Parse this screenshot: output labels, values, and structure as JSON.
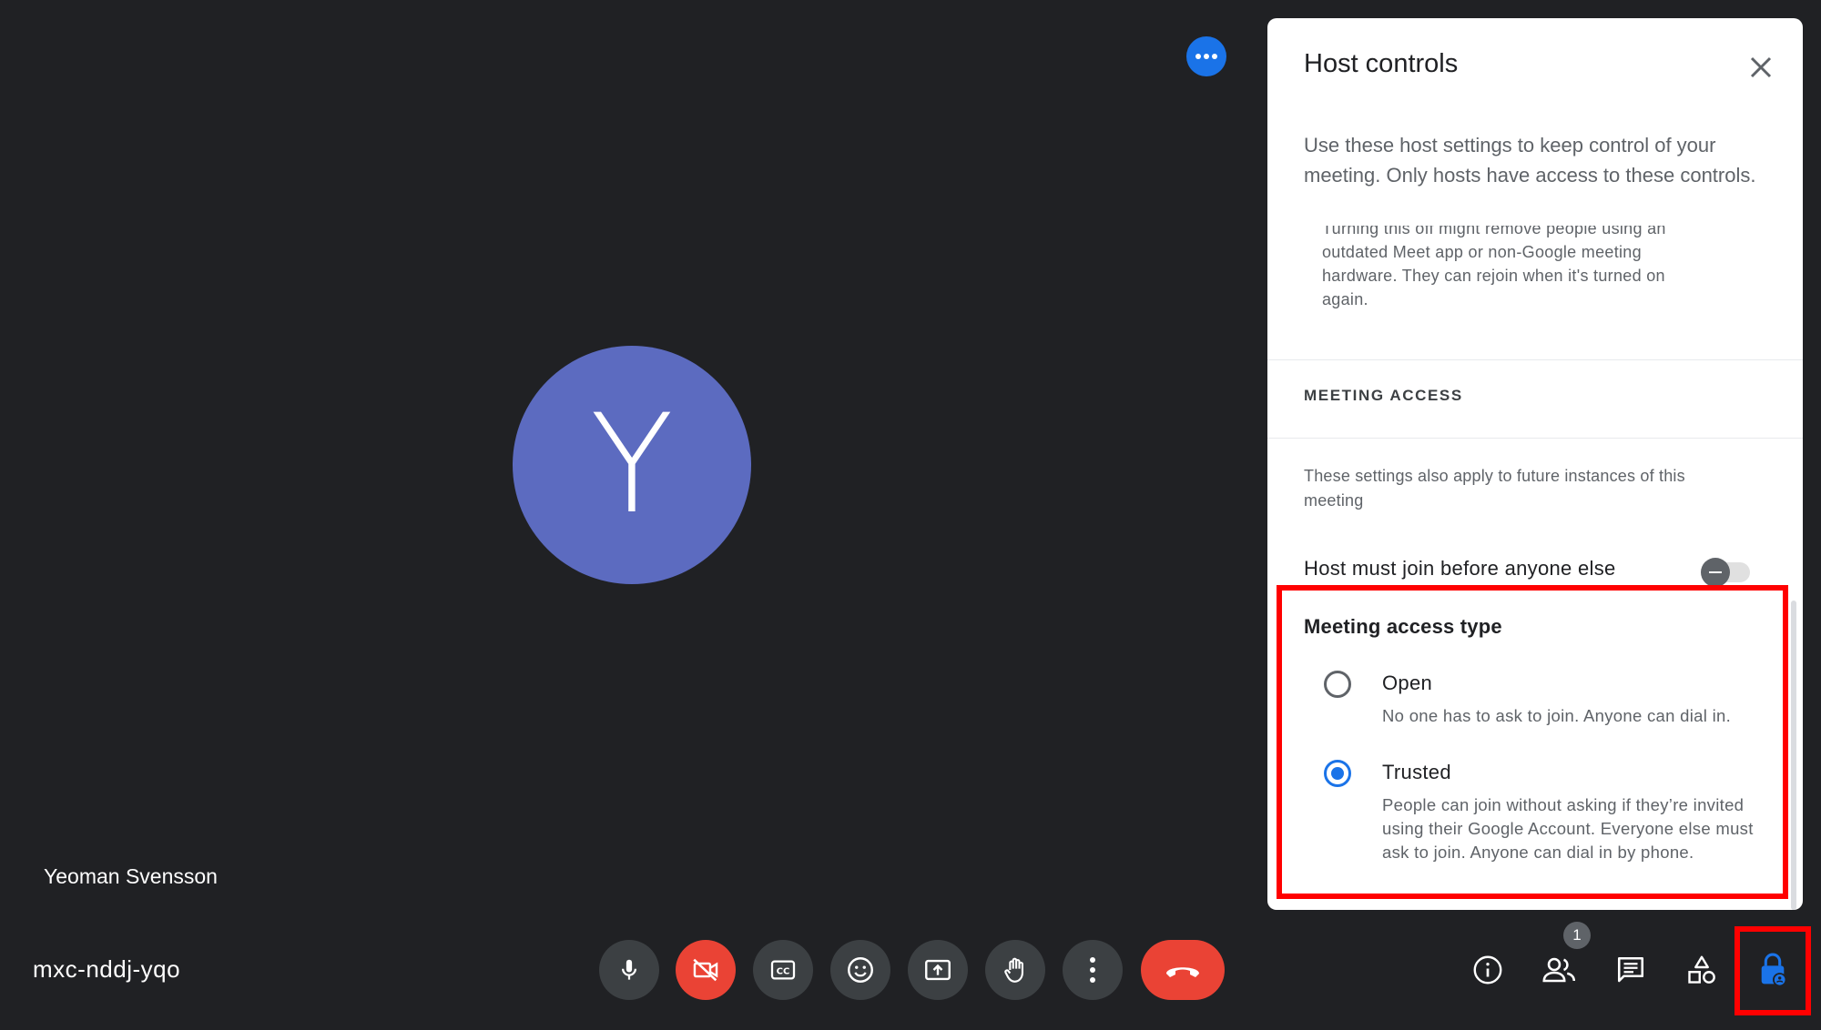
{
  "stage": {
    "avatar_letter": "Y",
    "participant_name": "Yeoman Svensson",
    "more_options_icon": "more-horiz-icon"
  },
  "bottom_bar": {
    "meeting_code": "mxc-nddj-yqo",
    "controls": [
      {
        "icon": "mic-icon"
      },
      {
        "icon": "camera-off-icon",
        "color": "#ea4335"
      },
      {
        "icon": "captions-icon"
      },
      {
        "icon": "emoji-icon"
      },
      {
        "icon": "present-icon"
      },
      {
        "icon": "raise-hand-icon"
      },
      {
        "icon": "more-vert-icon"
      },
      {
        "icon": "hang-up-icon",
        "color": "#ea4335"
      }
    ],
    "right_controls": [
      {
        "icon": "info-icon"
      },
      {
        "icon": "people-icon",
        "badge": "1"
      },
      {
        "icon": "chat-icon"
      },
      {
        "icon": "activities-icon"
      },
      {
        "icon": "host-controls-lock-icon",
        "color": "#1a73e8"
      }
    ]
  },
  "panel": {
    "title": "Host controls",
    "intro": "Use these host settings to keep control of your meeting. Only hosts have access to these controls.",
    "clipped_note": "Turning this off might remove people using an outdated Meet app or non-Google meeting hardware. They can rejoin when it's turned on again.",
    "section_heading": "MEETING ACCESS",
    "section_note": "These settings also apply to future instances of this meeting",
    "host_must_join": {
      "label": "Host must join before anyone else",
      "enabled": false
    },
    "access_type": {
      "title": "Meeting access type",
      "options": [
        {
          "label": "Open",
          "description": "No one has to ask to join. Anyone can dial in.",
          "selected": false
        },
        {
          "label": "Trusted",
          "description": "People can join without asking if they’re invited using their Google Account. Everyone else must ask to join. Anyone can dial in by phone.",
          "selected": true
        }
      ]
    }
  },
  "colors": {
    "background": "#202124",
    "accent": "#1a73e8",
    "danger": "#ea4335",
    "highlight": "#ff0000",
    "avatar": "#5c6bc0"
  }
}
